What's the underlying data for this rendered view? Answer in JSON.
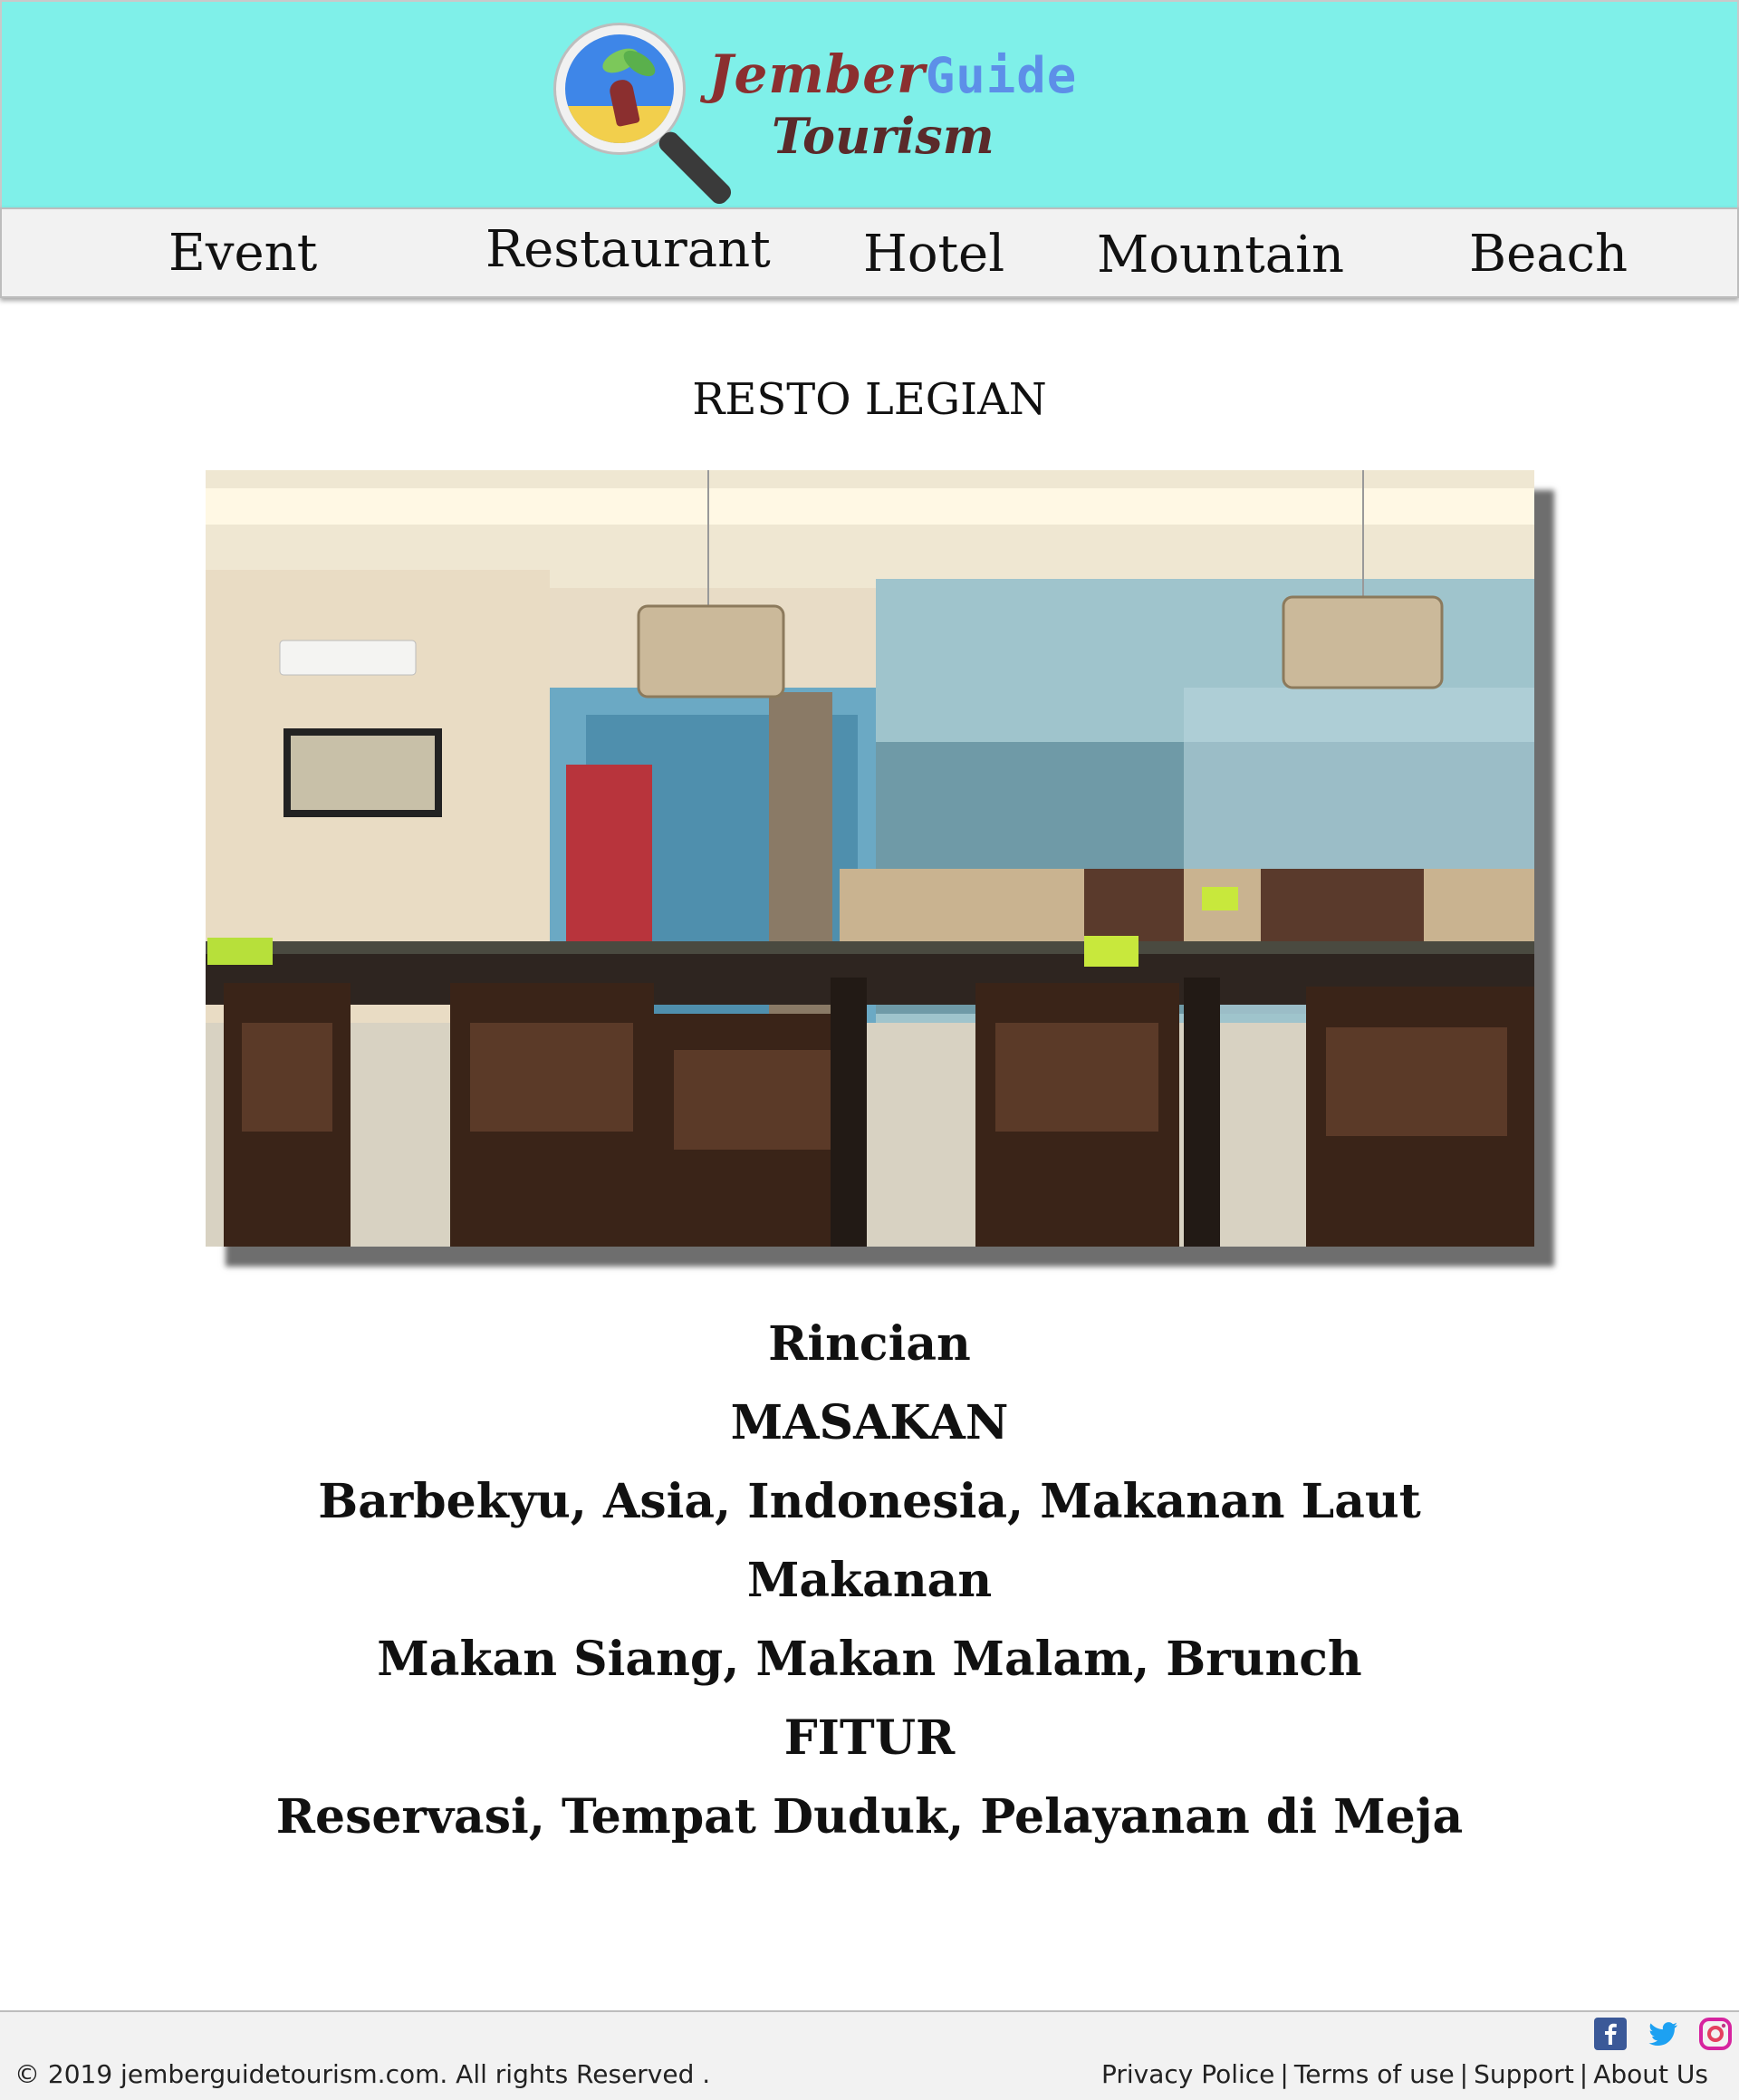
{
  "header": {
    "logo_text_jember": "Jember",
    "logo_text_guide": "Guide",
    "logo_text_tourism": "Tourism"
  },
  "nav": {
    "items": [
      {
        "label": "Event"
      },
      {
        "label": "Restaurant"
      },
      {
        "label": "Hotel"
      },
      {
        "label": "Mountain"
      },
      {
        "label": "Beach"
      }
    ]
  },
  "main": {
    "title": "RESTO LEGIAN",
    "details": [
      "Rincian",
      "MASAKAN",
      "Barbekyu, Asia, Indonesia, Makanan Laut",
      "Makanan",
      "Makan Siang, Makan Malam, Brunch",
      "FITUR",
      "Reservasi, Tempat Duduk, Pelayanan di Meja"
    ]
  },
  "footer": {
    "copyright": "© 2019 jemberguidetourism.com. All rights Reserved .",
    "links": [
      "Privacy Police",
      "Terms of use",
      "Support",
      "About Us"
    ],
    "separator": "|",
    "social_icons": [
      "facebook-icon",
      "twitter-icon",
      "instagram-icon"
    ]
  },
  "colors": {
    "header_bg": "#7ff0e9",
    "nav_bg": "#f2f2f2",
    "footer_bg": "#f2f2f2",
    "facebook": "#3b5998",
    "twitter": "#1da1f2",
    "instagram": "#d6249f"
  }
}
